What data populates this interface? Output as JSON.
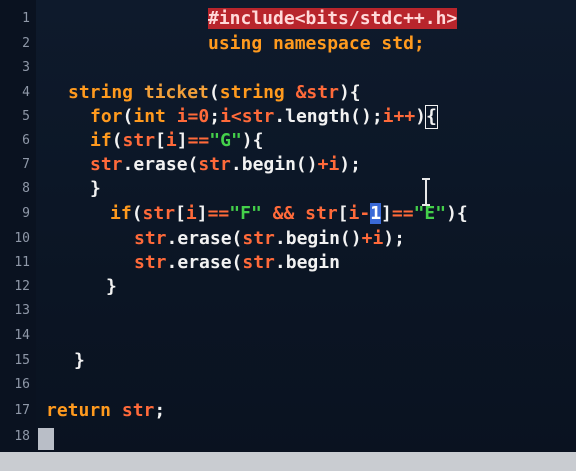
{
  "editor": {
    "lines": [
      {
        "num": "1",
        "indent": 208,
        "tokens": [
          {
            "t": "#include<bits/stdc++.h>",
            "c": "pre"
          }
        ]
      },
      {
        "num": "2",
        "indent": 208,
        "tokens": [
          {
            "t": "using namespace std;",
            "c": "kw"
          }
        ]
      },
      {
        "num": "3",
        "indent": 60,
        "tokens": []
      },
      {
        "num": "4",
        "indent": 68,
        "tokens": [
          {
            "t": "string ",
            "c": "type"
          },
          {
            "t": "ticket",
            "c": "fn"
          },
          {
            "t": "(",
            "c": "punct"
          },
          {
            "t": "string ",
            "c": "type"
          },
          {
            "t": "&str",
            "c": "var"
          },
          {
            "t": "){",
            "c": "punct"
          }
        ]
      },
      {
        "num": "5",
        "indent": 90,
        "tokens": [
          {
            "t": "for",
            "c": "kw"
          },
          {
            "t": "(",
            "c": "punct"
          },
          {
            "t": "int ",
            "c": "type"
          },
          {
            "t": "i=0",
            "c": "var"
          },
          {
            "t": ";",
            "c": "punct"
          },
          {
            "t": "i<",
            "c": "var"
          },
          {
            "t": "str",
            "c": "var"
          },
          {
            "t": ".length();",
            "c": "plain"
          },
          {
            "t": "i++",
            "c": "var"
          },
          {
            "t": ")",
            "c": "plain"
          },
          {
            "t": "{",
            "c": "cursor"
          }
        ]
      },
      {
        "num": "6",
        "indent": 90,
        "tokens": [
          {
            "t": "if",
            "c": "kw"
          },
          {
            "t": "(",
            "c": "punct"
          },
          {
            "t": "str",
            "c": "var"
          },
          {
            "t": "[",
            "c": "punct"
          },
          {
            "t": "i",
            "c": "var"
          },
          {
            "t": "]",
            "c": "punct"
          },
          {
            "t": "==",
            "c": "op"
          },
          {
            "t": "\"G\"",
            "c": "str"
          },
          {
            "t": "){",
            "c": "punct"
          }
        ]
      },
      {
        "num": "7",
        "indent": 90,
        "tokens": [
          {
            "t": "str",
            "c": "var"
          },
          {
            "t": ".erase(",
            "c": "plain"
          },
          {
            "t": "str",
            "c": "var"
          },
          {
            "t": ".begin()",
            "c": "plain"
          },
          {
            "t": "+",
            "c": "op"
          },
          {
            "t": "i",
            "c": "var"
          },
          {
            "t": ");",
            "c": "plain"
          }
        ]
      },
      {
        "num": "8",
        "indent": 90,
        "tokens": [
          {
            "t": "}",
            "c": "punct"
          }
        ]
      },
      {
        "num": "9",
        "indent": 110,
        "tokens": [
          {
            "t": "if",
            "c": "kw"
          },
          {
            "t": "(",
            "c": "punct"
          },
          {
            "t": "str",
            "c": "var"
          },
          {
            "t": "[",
            "c": "punct"
          },
          {
            "t": "i",
            "c": "var"
          },
          {
            "t": "]",
            "c": "punct"
          },
          {
            "t": "==",
            "c": "op"
          },
          {
            "t": "\"F\" ",
            "c": "str"
          },
          {
            "t": "&& ",
            "c": "op"
          },
          {
            "t": "str",
            "c": "var"
          },
          {
            "t": "[",
            "c": "punct"
          },
          {
            "t": "i-",
            "c": "var"
          },
          {
            "t": "1",
            "c": "hl"
          },
          {
            "t": "]",
            "c": "punct"
          },
          {
            "t": "==",
            "c": "op"
          },
          {
            "t": "\"E\"",
            "c": "str"
          },
          {
            "t": "){",
            "c": "punct"
          }
        ]
      },
      {
        "num": "10",
        "indent": 134,
        "tokens": [
          {
            "t": "str",
            "c": "var"
          },
          {
            "t": ".erase(",
            "c": "plain"
          },
          {
            "t": "str",
            "c": "var"
          },
          {
            "t": ".begin()",
            "c": "plain"
          },
          {
            "t": "+",
            "c": "op"
          },
          {
            "t": "i",
            "c": "var"
          },
          {
            "t": ");",
            "c": "plain"
          }
        ]
      },
      {
        "num": "11",
        "indent": 134,
        "tokens": [
          {
            "t": "str",
            "c": "var"
          },
          {
            "t": ".erase(",
            "c": "plain"
          },
          {
            "t": "str",
            "c": "var"
          },
          {
            "t": ".begin",
            "c": "plain"
          }
        ]
      },
      {
        "num": "12",
        "indent": 106,
        "tokens": [
          {
            "t": "}",
            "c": "punct"
          }
        ]
      },
      {
        "num": "13",
        "indent": 60,
        "tokens": []
      },
      {
        "num": "14",
        "indent": 60,
        "tokens": []
      },
      {
        "num": "15",
        "indent": 74,
        "tokens": [
          {
            "t": "}",
            "c": "punct"
          }
        ]
      },
      {
        "num": "16",
        "indent": 60,
        "tokens": []
      },
      {
        "num": "17",
        "indent": 46,
        "tokens": [
          {
            "t": "return ",
            "c": "kw"
          },
          {
            "t": "str",
            "c": "var"
          },
          {
            "t": ";",
            "c": "punct"
          }
        ]
      },
      {
        "num": "18",
        "indent": 40,
        "tokens": [
          {
            "t": "}",
            "c": "punct"
          }
        ]
      }
    ]
  }
}
